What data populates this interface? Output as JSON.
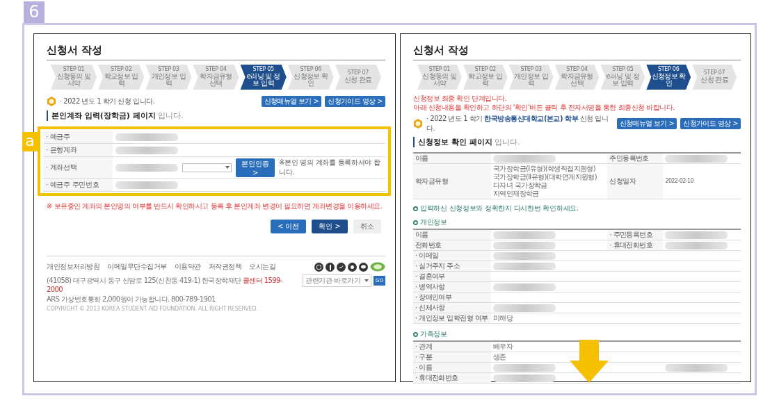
{
  "badge": "6",
  "panels": [
    {
      "kind": "account_form",
      "title": "신청서 작성",
      "steps": [
        {
          "number": "STEP 01",
          "label": "신청동의 및 서약",
          "selected": false
        },
        {
          "number": "STEP 02",
          "label": "학교정보 입력",
          "selected": false
        },
        {
          "number": "STEP 03",
          "label": "개인정보 입력",
          "selected": false
        },
        {
          "number": "STEP 04",
          "label": "학자금유형 선택",
          "selected": false
        },
        {
          "number": "STEP 05",
          "label": "e러닝 및 정보 입력",
          "selected": true
        },
        {
          "number": "STEP 06",
          "label": "신청정보 확인",
          "selected": false
        },
        {
          "number": "STEP 07",
          "label": "신청 완료",
          "selected": false
        }
      ],
      "notice": "· 2022 년도 1 학기 신청 입니다.",
      "guide_buttons": [
        "신청매뉴얼 보기 >",
        "신청가이드 영상 >"
      ],
      "heading": "**본인계좌 입력(장학금) 페이지** 입니다.",
      "callout": "a",
      "form_rows": [
        {
          "kind": "text",
          "label": "· 예금주",
          "blurred": true
        },
        {
          "kind": "text",
          "label": "· 은행계좌",
          "blurred": true
        },
        {
          "kind": "select",
          "label": "· 계좌선택",
          "blurred": true,
          "button": "본인인증 >",
          "note": "※본인 명의 계좌를 등록하셔야 합니다."
        },
        {
          "kind": "text",
          "label": "· 예금주 주민번호",
          "blurred": true
        }
      ],
      "warning": "※ 보유중인 계좌의 본인명의 여부를 반드시 확인하시고 등록 후 본인계좌 변경이 필요하면 계좌변경을 이용하세요.",
      "buttons": [
        {
          "kind": "prev",
          "label": "< 이전"
        },
        {
          "kind": "primary",
          "label": "확인 >"
        },
        {
          "kind": "plain",
          "label": "취소"
        }
      ],
      "footer": {
        "links": [
          "개인정보처리방침",
          "이메일무단수집거부",
          "이용약관",
          "저작권정책",
          "오시는길"
        ],
        "address_lines": [
          "(41058) 대구광역시 동구 신암로 125(신천동 419-1) 한국장학재단 **콜센터 1599-2000**",
          "ARS 가상번호통화 2,000원이 가능합니다. 800-789-1901"
        ],
        "copyright": "COPYRIGHT © 2013 KOREA STUDENT AID FOUNDATION. ALL RIGHT RESERVED.",
        "family_site": "관련기관 바로가기",
        "go": "GO"
      }
    },
    {
      "kind": "confirm",
      "title": "신청서 작성",
      "steps": [
        {
          "number": "STEP 01",
          "label": "신청동의 및 서약",
          "selected": false
        },
        {
          "number": "STEP 02",
          "label": "학교정보 입력",
          "selected": false
        },
        {
          "number": "STEP 03",
          "label": "개인정보 입력",
          "selected": false
        },
        {
          "number": "STEP 04",
          "label": "학자금유형 선택",
          "selected": false
        },
        {
          "number": "STEP 05",
          "label": "e러닝 및 정보 입력",
          "selected": false
        },
        {
          "number": "STEP 06",
          "label": "신청정보 확인",
          "selected": true
        },
        {
          "number": "STEP 07",
          "label": "신청 완료",
          "selected": false
        }
      ],
      "alerts": [
        "신청정보 최종 확인 단계입니다.",
        "아래 신청내용을 확인하고 하단의 '확인'버튼 클릭 후 전자서명을 통한 최종신청 바랍니다."
      ],
      "notice": "· 2022 년도 1 학기 **한국방송통신대학교(본교) 학부** 신청 입니다.",
      "guide_buttons": [
        "신청매뉴얼 보기 >",
        "신청가이드 영상 >"
      ],
      "heading": "**신청정보 확인 페이지** 입니다.",
      "summary_rows": [
        {
          "label": "이름",
          "blurred": true,
          "label2": "주민등록번호",
          "blurred2": true
        },
        {
          "label": "학자금유형",
          "value_lines": [
            "국가장학금(Ⅰ유형)(학생직접지원형)",
            "국가장학금(Ⅱ유형)(대학연계지원형)",
            "다자녀 국가장학금",
            "지역인재장학금"
          ],
          "label2": "신청일자",
          "value2": "2022-02-10"
        }
      ],
      "check_note": "입력하신 신청정보와 정확한지 다시한번 확인하세요.",
      "sections": [
        {
          "title": "개인정보",
          "rows": [
            {
              "label": "이름",
              "blurred": true,
              "label2": "· 주민등록번호",
              "blurred2": true
            },
            {
              "label": "전화번호",
              "blurred": true,
              "label2": "· 휴대전화번호",
              "blurred2": true
            },
            {
              "label": "· 이메일",
              "blurred": true
            },
            {
              "label": "· 실거주지 주소",
              "blurred": true
            },
            {
              "label": "· 결혼여부",
              "blurred": false
            },
            {
              "label": "· 병역사항",
              "blurred": true
            },
            {
              "label": "· 장애인여부",
              "blurred": false
            },
            {
              "label": "· 신체사항",
              "blurred": true
            },
            {
              "label": "· 개인정보 입학전형 여부",
              "value": "미해당"
            }
          ]
        },
        {
          "title": "가족정보",
          "rows": [
            {
              "label": "· 관계",
              "value": "배우자"
            },
            {
              "label": "· 구분",
              "value": "생존"
            },
            {
              "label": "· 이름",
              "blurred": true,
              "blurred2": true
            },
            {
              "label": "· 휴대전화번호",
              "blurred": true
            }
          ]
        }
      ]
    }
  ]
}
